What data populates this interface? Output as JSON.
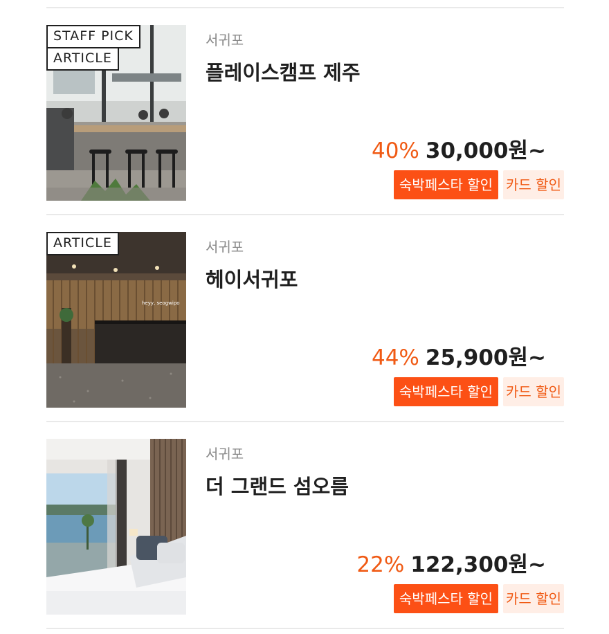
{
  "listings": [
    {
      "tags": [
        "STAFF PICK",
        "ARTICLE"
      ],
      "location": "서귀포",
      "name": "플레이스캠프 제주",
      "discount": "40%",
      "price": "30,000원~",
      "badges": {
        "festa": "숙박페스타 할인",
        "card": "카드 할인"
      },
      "photo_icon": "cafe-bar-interior-photo"
    },
    {
      "tags": [
        "ARTICLE"
      ],
      "location": "서귀포",
      "name": "헤이서귀포",
      "discount": "44%",
      "price": "25,900원~",
      "badges": {
        "festa": "숙박페스타 할인",
        "card": "카드 할인"
      },
      "photo_icon": "hotel-lobby-photo",
      "photo_sign": "heyy, seogwipo"
    },
    {
      "tags": [],
      "location": "서귀포",
      "name": "더 그랜드 섬오름",
      "discount": "22%",
      "price": "122,300원~",
      "badges": {
        "festa": "숙박페스타 할인",
        "card": "카드 할인"
      },
      "photo_icon": "hotel-bedroom-ocean-view-photo"
    }
  ],
  "colors": {
    "accent": "#f05a14",
    "badge_fill": "#fc5015",
    "card_badge_bg": "#ffeee6",
    "text": "#1f1f1f",
    "muted": "#8a8a8a",
    "divider": "#e9e9e9"
  }
}
